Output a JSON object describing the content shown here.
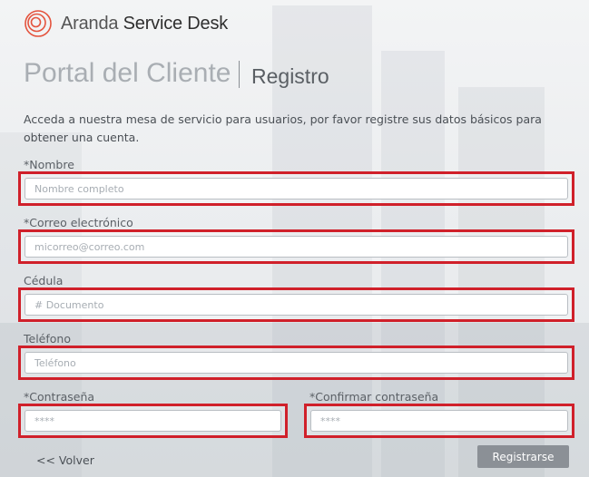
{
  "brand": {
    "name_light": "Aranda",
    "name_bold": "Service Desk",
    "logo_icon": "aranda-spiral-icon",
    "accent_color": "#e4533d"
  },
  "header": {
    "portal_title": "Portal del Cliente",
    "section_title": "Registro"
  },
  "intro_text": "Acceda a nuestra mesa de servicio para usuarios, por favor registre sus datos básicos para obtener una cuenta.",
  "form": {
    "name": {
      "label": "*Nombre",
      "placeholder": "Nombre completo",
      "value": ""
    },
    "email": {
      "label": "*Correo electrónico",
      "placeholder": "micorreo@correo.com",
      "value": ""
    },
    "id_doc": {
      "label": "Cédula",
      "placeholder": "# Documento",
      "value": ""
    },
    "phone": {
      "label": "Teléfono",
      "placeholder": "Teléfono",
      "value": ""
    },
    "password": {
      "label": "*Contraseña",
      "placeholder": "****",
      "value": ""
    },
    "confirm_password": {
      "label": "*Confirmar contraseña",
      "placeholder": "****",
      "value": ""
    }
  },
  "actions": {
    "back_label": "<< Volver",
    "register_label": "Registrarse"
  },
  "highlight_color": "#d0202a"
}
